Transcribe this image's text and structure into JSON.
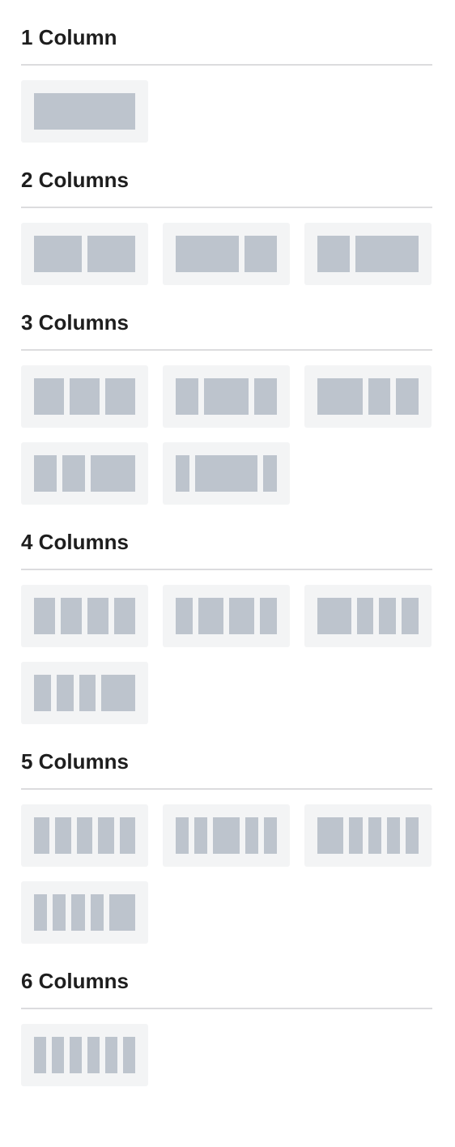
{
  "colors": {
    "tile_bg": "#f3f4f5",
    "column_fill": "#bdc4cd",
    "divider": "#dcdcde"
  },
  "sections": [
    {
      "title": "1 Column",
      "layouts": [
        {
          "label": "100",
          "widths": [
            100
          ]
        }
      ]
    },
    {
      "title": "2 Columns",
      "layouts": [
        {
          "label": "50 / 50",
          "widths": [
            50,
            50
          ]
        },
        {
          "label": "66 / 33",
          "widths": [
            66,
            34
          ]
        },
        {
          "label": "33 / 66",
          "widths": [
            34,
            66
          ]
        }
      ]
    },
    {
      "title": "3 Columns",
      "layouts": [
        {
          "label": "33 / 33 / 33",
          "widths": [
            33,
            33,
            33
          ]
        },
        {
          "label": "25 / 50 / 25",
          "widths": [
            25,
            50,
            25
          ]
        },
        {
          "label": "50 / 25 / 25",
          "widths": [
            50,
            25,
            25
          ]
        },
        {
          "label": "25 / 25 / 50",
          "widths": [
            25,
            25,
            50
          ]
        },
        {
          "label": "15 / 70 / 15",
          "widths": [
            15,
            70,
            15
          ]
        }
      ]
    },
    {
      "title": "4 Columns",
      "layouts": [
        {
          "label": "25 / 25 / 25 / 25",
          "widths": [
            25,
            25,
            25,
            25
          ]
        },
        {
          "label": "20 / 30 / 30 / 20",
          "widths": [
            20,
            30,
            30,
            20
          ]
        },
        {
          "label": "40 / 20 / 20 / 20",
          "widths": [
            40,
            20,
            20,
            20
          ]
        },
        {
          "label": "20 / 20 / 20 / 40",
          "widths": [
            20,
            20,
            20,
            40
          ]
        }
      ]
    },
    {
      "title": "5 Columns",
      "layouts": [
        {
          "label": "20 x 5",
          "widths": [
            20,
            20,
            20,
            20,
            20
          ]
        },
        {
          "label": "15 / 15 / 30 / 15 / 15",
          "widths": [
            15,
            15,
            30,
            15,
            15
          ]
        },
        {
          "label": "30 / 15 / 15 / 15 / 15",
          "widths": [
            30,
            15,
            15,
            15,
            15
          ]
        },
        {
          "label": "15 / 15 / 15 / 15 / 30",
          "widths": [
            15,
            15,
            15,
            15,
            30
          ]
        }
      ]
    },
    {
      "title": "6 Columns",
      "layouts": [
        {
          "label": "16 x 6",
          "widths": [
            16,
            16,
            16,
            16,
            16,
            16
          ]
        }
      ]
    }
  ]
}
